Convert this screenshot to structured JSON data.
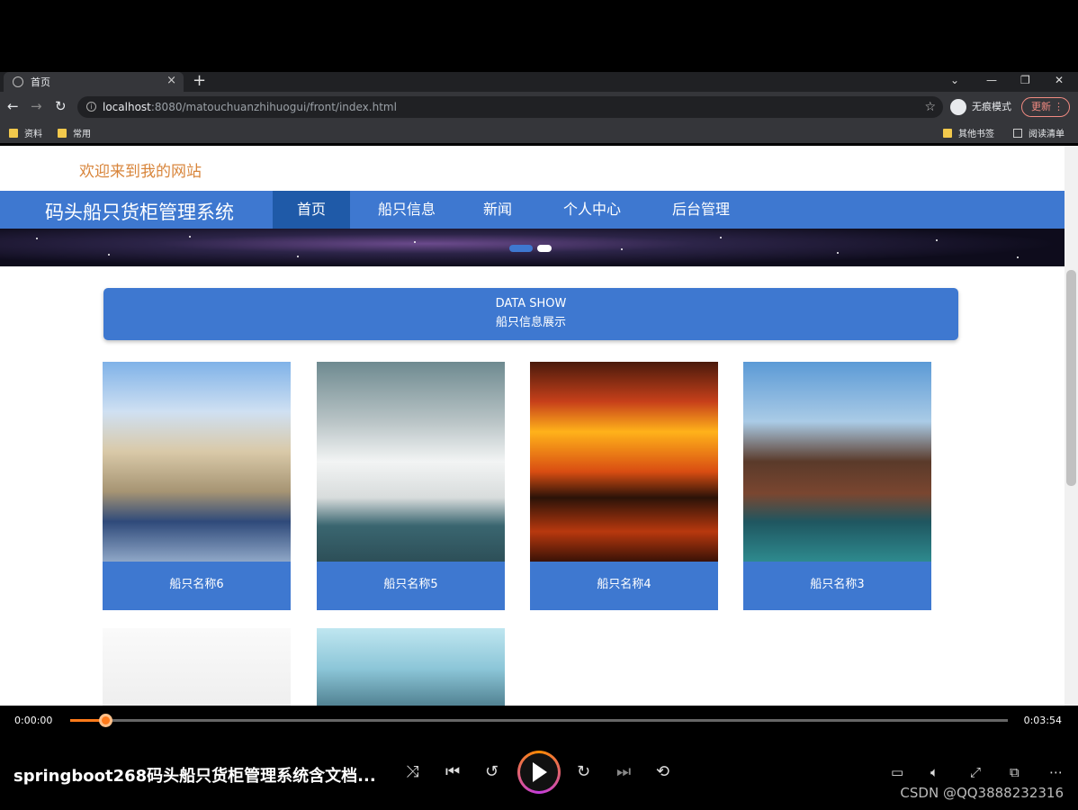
{
  "browser": {
    "tab_title": "首页",
    "tab_close": "×",
    "new_tab": "+",
    "url_host": "localhost",
    "url_rest": ":8080/matouchuanzhihuogui/front/index.html",
    "incognito_label": "无痕模式",
    "update_label": "更新",
    "bookmarks": [
      "资料",
      "常用"
    ],
    "other_bookmarks": "其他书签",
    "reading_list": "阅读清单"
  },
  "page": {
    "welcome": "欢迎来到我的网站",
    "site_title": "码头船只货柜管理系统",
    "nav": [
      "首页",
      "船只信息",
      "新闻",
      "个人中心",
      "后台管理"
    ],
    "active_nav": "首页",
    "section_en": "DATA SHOW",
    "section_cn": "船只信息展示",
    "cards": [
      "船只名称6",
      "船只名称5",
      "船只名称4",
      "船只名称3"
    ]
  },
  "player": {
    "time_current": "0:00:00",
    "time_total": "0:03:54",
    "progress": 0.038,
    "video_title": "springboot268码头船只货柜管理系统含文档...",
    "watermark": "CSDN @QQ3888232316",
    "accent": "#ff7a1a"
  },
  "colors": {
    "nav_blue": "#3e78d0",
    "nav_active": "#1f5aa8",
    "welcome_orange": "#d8853b"
  }
}
